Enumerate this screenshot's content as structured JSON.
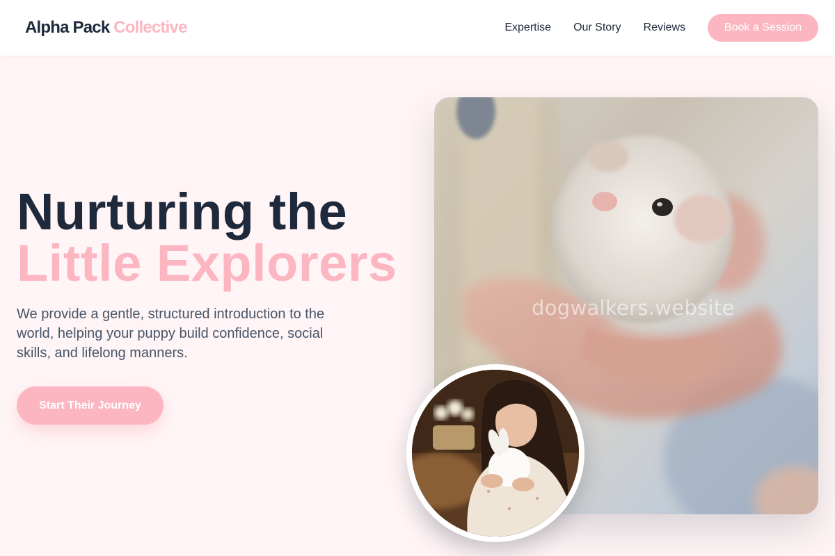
{
  "header": {
    "logo_main": "Alpha Pack",
    "logo_accent": "Collective",
    "nav": [
      "Expertise",
      "Our Story",
      "Reviews"
    ],
    "book_label": "Book a Session"
  },
  "hero": {
    "headline_line1": "Nurturing the",
    "headline_line2": "Little Explorers",
    "subtext": "We provide a gentle, structured introduction to the world, helping your puppy build confidence, social skills, and lifelong manners.",
    "cta_label": "Start Their Journey"
  },
  "images": {
    "main_photo_watermark": "dogwalkers.website"
  },
  "colors": {
    "accent": "#fbb6c1",
    "heading": "#1e293b",
    "body_text": "#475569",
    "page_background": "#fff5f6"
  }
}
